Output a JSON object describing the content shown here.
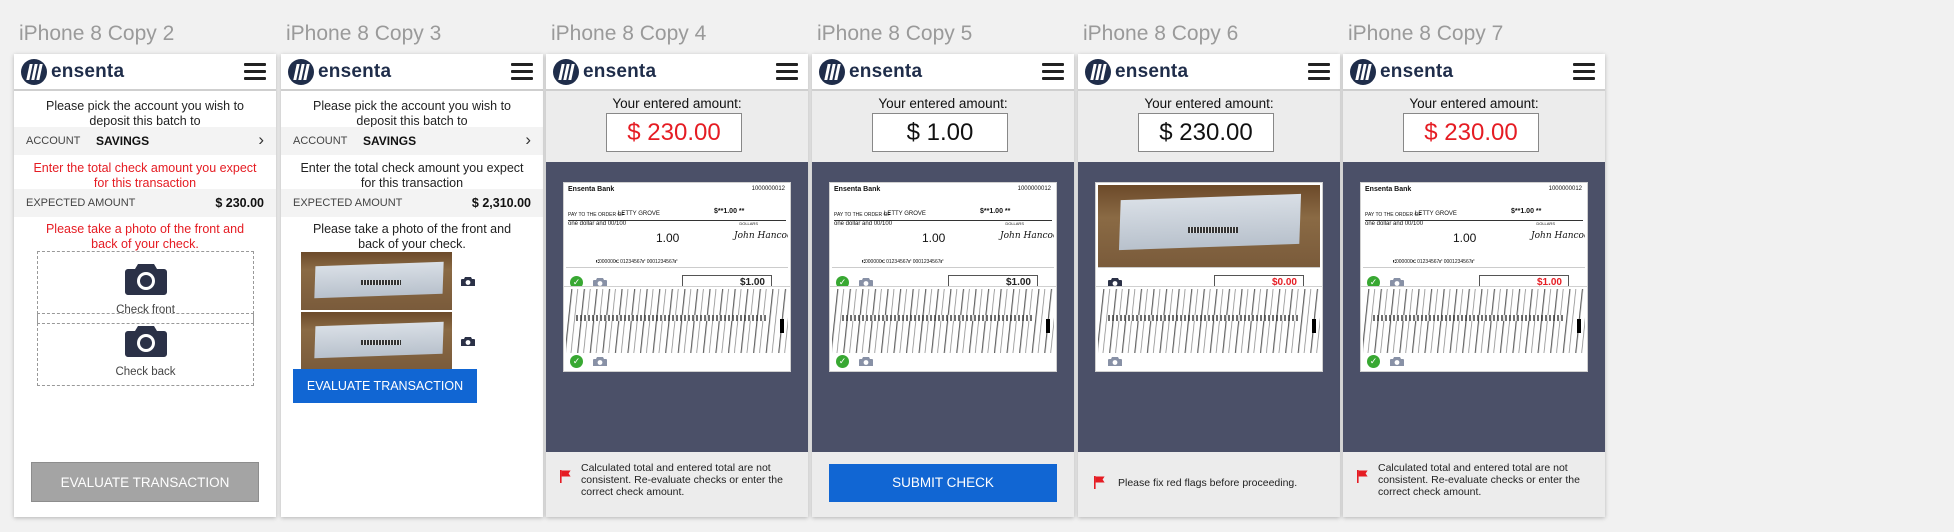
{
  "app": {
    "brand": "ensenta"
  },
  "screens": [
    {
      "title": "iPhone 8 Copy 2",
      "pick_msg": "Please pick the account you wish to deposit this batch to",
      "account_label": "ACCOUNT",
      "account_value": "SAVINGS",
      "enter_msg": "Enter the total check amount you expect for this transaction",
      "expected_label": "EXPECTED AMOUNT",
      "expected_value": "$ 230.00",
      "photo_msg": "Please take a photo of the front and back of your check.",
      "front_caption": "Check front",
      "back_caption": "Check back",
      "button": "EVALUATE TRANSACTION"
    },
    {
      "title": "iPhone 8 Copy 3",
      "pick_msg": "Please pick the account you wish to deposit this batch to",
      "account_label": "ACCOUNT",
      "account_value": "SAVINGS",
      "enter_msg": "Enter the total check amount you expect for this transaction",
      "expected_label": "EXPECTED AMOUNT",
      "expected_value": "$ 2,310.00",
      "photo_msg": "Please take a photo of the front and back of your check.",
      "button": "EVALUATE TRANSACTION"
    },
    {
      "title": "iPhone 8 Copy 4",
      "entered_label": "Your entered amount:",
      "entered_value": "$ 230.00",
      "check_amount": "$1.00",
      "footer": "Calculated total and entered total are not consistent. Re-evaluate checks or enter the correct check amount."
    },
    {
      "title": "iPhone 8 Copy 5",
      "entered_label": "Your entered amount:",
      "entered_value": "$ 1.00",
      "check_amount": "$1.00",
      "button": "SUBMIT CHECK"
    },
    {
      "title": "iPhone 8 Copy 6",
      "entered_label": "Your entered amount:",
      "entered_value": "$ 230.00",
      "check_amount": "$0.00",
      "footer": "Please fix red flags before proceeding."
    },
    {
      "title": "iPhone 8 Copy 7",
      "entered_label": "Your entered amount:",
      "entered_value": "$ 230.00",
      "check_amount": "$1.00",
      "footer": "Calculated total and entered total are not consistent. Re-evaluate checks or enter the correct check amount."
    }
  ],
  "check": {
    "bank": "Ensenta Bank",
    "number": "1000000012",
    "payee_prefix": "PAY TO THE ORDER OF",
    "payee": "LETTY GROVE",
    "amount_box": "$**1.00 **",
    "written": "one dollar and 00/100",
    "dollars": "DOLLARS",
    "amount_center": "1.00",
    "signature": "John Hancock",
    "micr": "⑆000000⑆ 01234567⑈ 0001234567⑈"
  },
  "colors": {
    "brand": "#1f2d4a",
    "accent_blue": "#1166d3",
    "error_red": "#e51c23",
    "ok_green": "#38a832",
    "panel": "#4b5068"
  },
  "icons": [
    "hamburger-menu-icon",
    "camera-icon",
    "check-circle-icon",
    "red-flag-icon",
    "chevron-right-icon",
    "ensenta-logo"
  ]
}
